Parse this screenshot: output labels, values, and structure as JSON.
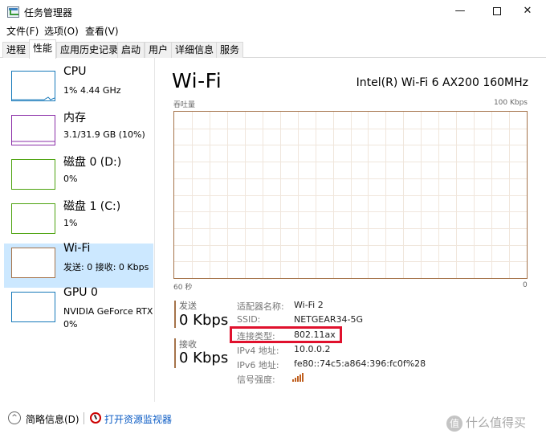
{
  "window": {
    "title": "任务管理器",
    "min": "—",
    "close": "✕"
  },
  "menu": [
    "文件(F)",
    "选项(O)",
    "查看(V)"
  ],
  "tabs": [
    "进程",
    "性能",
    "应用历史记录",
    "启动",
    "用户",
    "详细信息",
    "服务"
  ],
  "sidebar": {
    "items": [
      {
        "name": "CPU",
        "sub": "1% 4.44 GHz",
        "color": "#1779ba"
      },
      {
        "name": "内存",
        "sub": "3.1/31.9 GB (10%)",
        "color": "#8b2fa8"
      },
      {
        "name": "磁盘 0 (D:)",
        "sub": "0%",
        "color": "#4da30f"
      },
      {
        "name": "磁盘 1 (C:)",
        "sub": "1%",
        "color": "#4da30f"
      },
      {
        "name": "Wi-Fi",
        "sub": "发送: 0 接收: 0 Kbps",
        "color": "#a5734a"
      },
      {
        "name": "GPU 0",
        "sub": "NVIDIA GeForce RTX",
        "sub2": "0%",
        "color": "#1779ba"
      }
    ]
  },
  "main": {
    "title": "Wi-Fi",
    "adapter": "Intel(R) Wi-Fi 6 AX200 160MHz",
    "throughput_label": "吞吐量",
    "max_label": "100 Kbps",
    "time_label": "60 秒",
    "zero_label": "0"
  },
  "stats": {
    "send_label": "发送",
    "send_value": "0 Kbps",
    "recv_label": "接收",
    "recv_value": "0 Kbps"
  },
  "properties": [
    {
      "label": "适配器名称:",
      "value": "Wi-Fi 2"
    },
    {
      "label": "SSID:",
      "value": "NETGEAR34-5G"
    },
    {
      "label": "连接类型:",
      "value": "802.11ax"
    },
    {
      "label": "IPv4 地址:",
      "value": "10.0.0.2"
    },
    {
      "label": "IPv6 地址:",
      "value": "fe80::74c5:a864:396:fc0f%28"
    },
    {
      "label": "信号强度:",
      "value": ""
    }
  ],
  "footer": {
    "fewer": "简略信息(D)",
    "monitor": "打开资源监视器"
  },
  "watermark": {
    "badge": "值",
    "text": "什么值得买"
  }
}
